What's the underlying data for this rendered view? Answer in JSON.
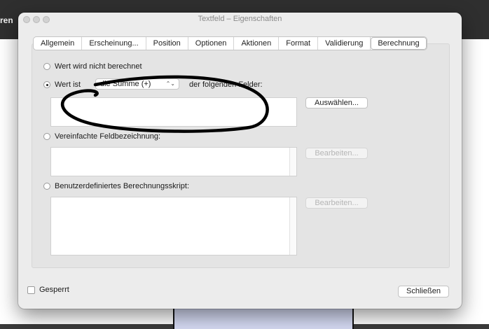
{
  "background_app": {
    "topbar_text": "ren"
  },
  "dialog": {
    "title": "Textfeld – Eigenschaften",
    "tabs": [
      {
        "label": "Allgemein"
      },
      {
        "label": "Erscheinung..."
      },
      {
        "label": "Position"
      },
      {
        "label": "Optionen"
      },
      {
        "label": "Aktionen"
      },
      {
        "label": "Format"
      },
      {
        "label": "Validierung"
      },
      {
        "label": "Berechnung"
      }
    ],
    "active_tab": "Berechnung",
    "calc": {
      "option_none": "Wert wird nicht berechnet",
      "option_value_is": "Wert ist",
      "operation_selected": "die Summe (+)",
      "following_fields": "der folgenden Felder:",
      "select_button": "Auswählen...",
      "option_simplified": "Vereinfachte Feldbezeichnung:",
      "edit_button_1": "Bearbeiten...",
      "option_custom": "Benutzerdefiniertes Berechnungsskript:",
      "edit_button_2": "Bearbeiten...",
      "selected_option": "Wert ist"
    },
    "locked_label": "Gesperrt",
    "locked_checked": false,
    "close_button": "Schließen"
  }
}
